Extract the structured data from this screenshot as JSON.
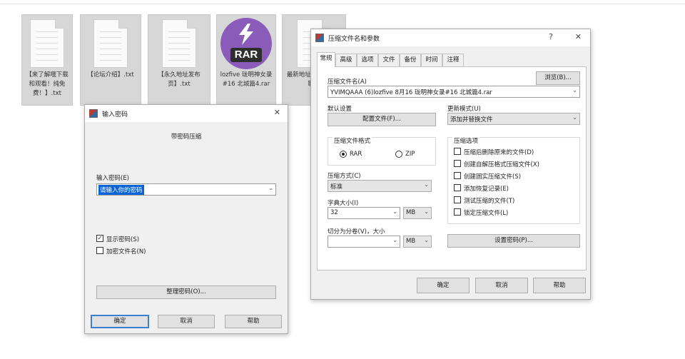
{
  "desktop": {
    "files": [
      {
        "name": "【来了解哦下载和观看！纯免费！】.txt"
      },
      {
        "name": "【论坛介绍】.txt"
      },
      {
        "name": "【永久地址发布页】.txt"
      },
      {
        "name": "lozfive 珑明神女录#16 北城篇4.rar",
        "icon_text": "RAR"
      },
      {
        "name": "最新地址请发邮件获取！"
      }
    ]
  },
  "password_dialog": {
    "title": "输入密码",
    "close_glyph": "✕",
    "subtitle": "带密码压缩",
    "label": "输入密码(E)",
    "password_value": "请输入你的密码",
    "show_password": {
      "label": "显示密码(S)",
      "checked": true
    },
    "encrypt_names": {
      "label": "加密文件名(N)",
      "checked": false
    },
    "manage_button": "整理密码(O)...",
    "ok": "确定",
    "cancel": "取消",
    "help": "帮助"
  },
  "archive_dialog": {
    "title": "压缩文件名和参数",
    "help_glyph": "?",
    "close_glyph": "✕",
    "tabs": [
      "常规",
      "高级",
      "选项",
      "文件",
      "备份",
      "时间",
      "注释"
    ],
    "active_tab": "常规",
    "archive_name_label": "压缩文件名(A)",
    "browse_button": "浏览(B)...",
    "archive_name_value": "YVIMQAAA (6)lozfive 8月16 珑明神女录#16 北城篇4.rar",
    "profile_label": "默认设置",
    "profile_button": "配置文件(F)...",
    "update_mode_label": "更新模式(U)",
    "update_mode_value": "添加并替换文件",
    "format_group_label": "压缩文件格式",
    "format_rar": "RAR",
    "format_zip": "ZIP",
    "format_selected": "RAR",
    "options_group_label": "压缩选项",
    "options": [
      {
        "label": "压缩后删除原来的文件(D)",
        "checked": false
      },
      {
        "label": "创建自解压格式压缩文件(X)",
        "checked": false
      },
      {
        "label": "创建固实压缩文件(S)",
        "checked": false
      },
      {
        "label": "添加恢复记录(E)",
        "checked": false
      },
      {
        "label": "测试压缩的文件(T)",
        "checked": false
      },
      {
        "label": "锁定压缩文件(L)",
        "checked": false
      }
    ],
    "method_label": "压缩方式(C)",
    "method_value": "标准",
    "dict_label": "字典大小(I)",
    "dict_value": "32",
    "dict_unit": "MB",
    "split_label": "切分为分卷(V)，大小",
    "split_value": "",
    "split_unit": "MB",
    "set_password_button": "设置密码(P)...",
    "ok": "确定",
    "cancel": "取消",
    "help": "帮助"
  },
  "colors": {
    "accent": "#3c7fd1",
    "rar_purple": "#8a5bb8",
    "selection": "#0a64d6"
  }
}
